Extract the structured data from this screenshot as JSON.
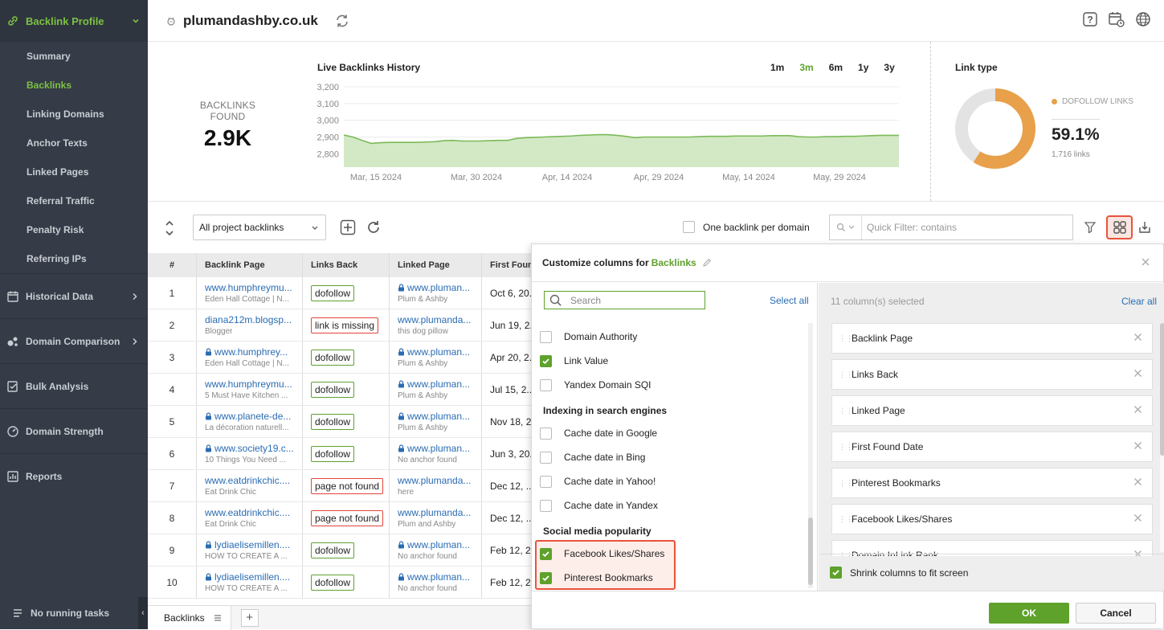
{
  "sidebar": {
    "header": "Backlink Profile",
    "subitems": [
      "Summary",
      "Backlinks",
      "Linking Domains",
      "Anchor Texts",
      "Linked Pages",
      "Referral Traffic",
      "Penalty Risk",
      "Referring IPs"
    ],
    "active_index": 1,
    "sections": [
      "Historical Data",
      "Domain Comparison",
      "Bulk Analysis",
      "Domain Strength",
      "Reports"
    ],
    "footer": "No running tasks"
  },
  "header": {
    "domain": "plumandashby.co.uk"
  },
  "stats": {
    "found_label": "BACKLINKS FOUND",
    "found_value": "2.9K",
    "history_title": "Live Backlinks History",
    "ranges": [
      "1m",
      "3m",
      "6m",
      "1y",
      "3y"
    ],
    "active_range": "3m",
    "link_type_title": "Link type",
    "legend": "DOFOLLOW LINKS",
    "pct": "59.1%",
    "links": "1,716 links",
    "colors": {
      "dofollow": "#e8a04a",
      "other": "#e3e3e3",
      "line": "#7cba58",
      "fill": "#d3e9c5"
    }
  },
  "chart_data": {
    "type": "area",
    "title": "Live Backlinks History",
    "y_ticks": [
      "3,200",
      "3,100",
      "3,000",
      "2,900",
      "2,800"
    ],
    "ylim": [
      2720,
      3200
    ],
    "x_ticks": [
      "Mar, 15 2024",
      "Mar, 30 2024",
      "Apr, 14 2024",
      "Apr, 29 2024",
      "May, 14 2024",
      "May, 29 2024"
    ],
    "values": [
      2912,
      2900,
      2880,
      2862,
      2866,
      2868,
      2868,
      2868,
      2868,
      2870,
      2872,
      2878,
      2880,
      2876,
      2876,
      2876,
      2878,
      2880,
      2880,
      2892,
      2896,
      2898,
      2900,
      2902,
      2904,
      2906,
      2910,
      2912,
      2914,
      2914,
      2910,
      2904,
      2896,
      2900,
      2900,
      2900,
      2900,
      2900,
      2900,
      2902,
      2904,
      2904,
      2904,
      2906,
      2906,
      2906,
      2906,
      2908,
      2908,
      2908,
      2902,
      2900,
      2900,
      2902,
      2902,
      2904,
      2904,
      2906,
      2908,
      2910,
      2910,
      2910
    ]
  },
  "donut": {
    "dofollow_pct": 59.1
  },
  "toolbar": {
    "select_value": "All project backlinks",
    "one_per_domain": "One backlink per domain",
    "quick_filter_placeholder": "Quick Filter: contains"
  },
  "table": {
    "headers": [
      "#",
      "Backlink Page",
      "Links Back",
      "Linked Page",
      "First Foun..."
    ],
    "rows": [
      {
        "n": "1",
        "page": "www.humphreymu...",
        "sub": "Eden Hall Cottage | N...",
        "lock": false,
        "status": "dofollow",
        "ok": true,
        "linked": "www.pluman...",
        "lsub": "Plum & Ashby",
        "llock": true,
        "date": "Oct 6, 20..."
      },
      {
        "n": "2",
        "page": "diana212m.blogsp...",
        "sub": "Blogger",
        "lock": false,
        "status": "link is missing",
        "ok": false,
        "linked": "www.plumanda...",
        "lsub": "this dog pillow",
        "llock": false,
        "date": "Jun 19, 2..."
      },
      {
        "n": "3",
        "page": "www.humphrey...",
        "sub": "Eden Hall Cottage | N...",
        "lock": true,
        "status": "dofollow",
        "ok": true,
        "linked": "www.pluman...",
        "lsub": "Plum & Ashby",
        "llock": true,
        "date": "Apr 20, 2..."
      },
      {
        "n": "4",
        "page": "www.humphreymu...",
        "sub": "5 Must Have Kitchen ...",
        "lock": false,
        "status": "dofollow",
        "ok": true,
        "linked": "www.pluman...",
        "lsub": "Plum & Ashby",
        "llock": true,
        "date": "Jul 15, 2..."
      },
      {
        "n": "5",
        "page": "www.planete-de...",
        "sub": "La décoration naturell...",
        "lock": true,
        "status": "dofollow",
        "ok": true,
        "linked": "www.pluman...",
        "lsub": "Plum & Ashby",
        "llock": true,
        "date": "Nov 18, 2..."
      },
      {
        "n": "6",
        "page": "www.society19.c...",
        "sub": "10 Things You Need ...",
        "lock": true,
        "status": "dofollow",
        "ok": true,
        "linked": "www.pluman...",
        "lsub": "No anchor found",
        "llock": true,
        "date": "Jun 3, 20..."
      },
      {
        "n": "7",
        "page": "www.eatdrinkchic....",
        "sub": "Eat Drink Chic",
        "lock": false,
        "status": "page not found",
        "ok": false,
        "linked": "www.plumanda...",
        "lsub": "here",
        "llock": false,
        "date": "Dec 12, ..."
      },
      {
        "n": "8",
        "page": "www.eatdrinkchic....",
        "sub": "Eat Drink Chic",
        "lock": false,
        "status": "page not found",
        "ok": false,
        "linked": "www.plumanda...",
        "lsub": "Plum and Ashby",
        "llock": false,
        "date": "Dec 12, ..."
      },
      {
        "n": "9",
        "page": "lydiaelisemillen....",
        "sub": "HOW TO CREATE A ...",
        "lock": true,
        "status": "dofollow",
        "ok": true,
        "linked": "www.pluman...",
        "lsub": "No anchor found",
        "llock": true,
        "date": "Feb 12, 2..."
      },
      {
        "n": "10",
        "page": "lydiaelisemillen....",
        "sub": "HOW TO CREATE A ...",
        "lock": true,
        "status": "dofollow",
        "ok": true,
        "linked": "www.pluman...",
        "lsub": "No anchor found",
        "llock": true,
        "date": "Feb 12, 2..."
      }
    ]
  },
  "bottom": {
    "tab": "Backlinks"
  },
  "dialog": {
    "title_prefix": "Customize columns for",
    "title_target": "Backlinks",
    "search_placeholder": "Search",
    "select_all": "Select all",
    "options_a": [
      {
        "label": "Domain Authority",
        "checked": false
      },
      {
        "label": "Link Value",
        "checked": true
      },
      {
        "label": "Yandex Domain SQI",
        "checked": false
      }
    ],
    "group_b": "Indexing in search engines",
    "options_b": [
      {
        "label": "Cache date in Google",
        "checked": false
      },
      {
        "label": "Cache date in Bing",
        "checked": false
      },
      {
        "label": "Cache date in Yahoo!",
        "checked": false
      },
      {
        "label": "Cache date in Yandex",
        "checked": false
      }
    ],
    "group_c": "Social media popularity",
    "options_c": [
      {
        "label": "Facebook Likes/Shares",
        "checked": true
      },
      {
        "label": "Pinterest Bookmarks",
        "checked": true
      }
    ],
    "selected_count": "11 column(s) selected",
    "clear_all": "Clear all",
    "selected": [
      "Backlink Page",
      "Links Back",
      "Linked Page",
      "First Found Date",
      "Pinterest Bookmarks",
      "Facebook Likes/Shares",
      "Domain InLink Rank"
    ],
    "shrink": "Shrink columns to fit screen",
    "ok": "OK",
    "cancel": "Cancel"
  }
}
